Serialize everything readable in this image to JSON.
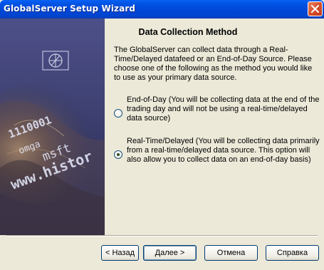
{
  "window": {
    "title": "GlobalServer Setup Wizard"
  },
  "banner": {
    "digits": "1110001",
    "text1": "omga",
    "text2": "msft",
    "text3": "www.histor"
  },
  "page": {
    "title": "Data Collection Method",
    "intro": "The GlobalServer can collect data through a Real-Time/Delayed datafeed or an End-of-Day Source. Please choose one of the following as the method you would like to use as your primary data source."
  },
  "options": [
    {
      "label": "End-of-Day (You will be collecting data at the end of the trading day and will not be using a real-time/delayed data source)",
      "selected": false
    },
    {
      "label": "Real-Time/Delayed (You will be collecting data primarily from a real-time/delayed data source. This option will also allow you to collect data on an end-of-day basis)",
      "selected": true
    }
  ],
  "buttons": {
    "back": "< Назад",
    "next": "Далее >",
    "cancel": "Отмена",
    "help": "Справка"
  }
}
